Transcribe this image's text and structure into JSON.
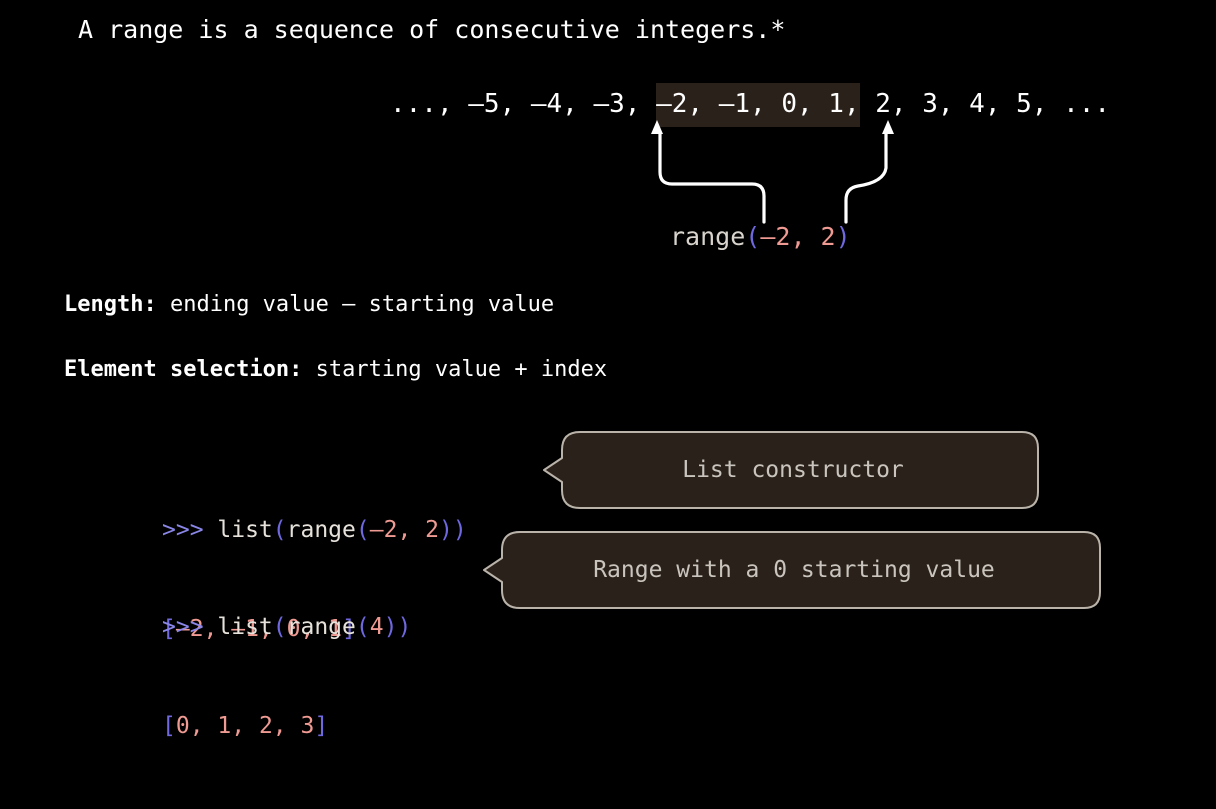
{
  "slide": {
    "background_color": "#000000",
    "headline": "A range is a sequence of consecutive integers.*",
    "sequence": {
      "prefix": "..., –5, –4, –3, ",
      "highlighted": "–2, –1, 0, 1,",
      "suffix": " 2, 3, 4, 5, ...",
      "highlight_color": "#2b211b"
    },
    "range_label": {
      "name": "range",
      "open_paren": "(",
      "start": "–2",
      "separator": ", ",
      "stop": "2",
      "close_paren": ")"
    },
    "definitions": [
      {
        "lead": "Length:",
        "body": " ending value – starting value"
      },
      {
        "lead": "Element selection:",
        "body": " starting value + index"
      }
    ],
    "code_examples": [
      {
        "prompt": ">>> ",
        "call_head": "list",
        "open1": "(",
        "inner_name": "range",
        "open2": "(",
        "arg1": "–2",
        "comma": ", ",
        "arg2": "2",
        "close2": ")",
        "close1": ")",
        "result_open": "[",
        "result_values": "–2, –1, 0, 1",
        "result_close": "]",
        "callout": "List constructor"
      },
      {
        "prompt": ">>> ",
        "call_head": "list",
        "open1": "(",
        "inner_name": "range",
        "open2": "(",
        "arg1": "4",
        "comma": "",
        "arg2": "",
        "close2": ")",
        "close1": ")",
        "result_open": "[",
        "result_values": "0, 1, 2, 3",
        "result_close": "]",
        "callout": "Range with a 0 starting value"
      }
    ],
    "colors": {
      "prompt": "#8a86e8",
      "paren": "#6f68e0",
      "bracket": "#6f68e0",
      "number": "#ef9a92",
      "identifier": "#d8d4cd",
      "plain_code": "#e6e2db",
      "bubble_fill": "#2b211b",
      "bubble_border": "#b9b3aa",
      "bubble_text": "#c9c5be",
      "arrow": "#ffffff",
      "text": "#ffffff"
    }
  }
}
